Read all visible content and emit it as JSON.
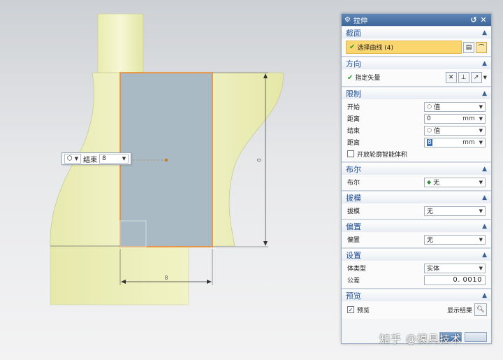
{
  "viewport": {
    "toolbar": {
      "mode_label": "结束",
      "value": "8"
    },
    "dimensions": {
      "height_label": "0",
      "width_label": "8"
    }
  },
  "dialog": {
    "title": "拉伸",
    "sections": {
      "section": {
        "title": "截面",
        "select_curve": "选择曲线 (4)"
      },
      "direction": {
        "title": "方向",
        "specify_vector": "指定矢量"
      },
      "limits": {
        "title": "限制",
        "start_label": "开始",
        "start_value": "值",
        "distance1_label": "距离",
        "distance1_value": "0",
        "distance1_unit": "mm",
        "end_label": "结束",
        "end_value": "值",
        "distance2_label": "距离",
        "distance2_value": "8",
        "distance2_unit": "mm",
        "open_profile_label": "开放轮廓智能体积"
      },
      "boolean": {
        "title": "布尔",
        "label": "布尔",
        "value": "无"
      },
      "draft": {
        "title": "拔模",
        "label": "拔模",
        "value": "无"
      },
      "offset": {
        "title": "偏置",
        "label": "偏置",
        "value": "无"
      },
      "settings": {
        "title": "设置",
        "body_type_label": "体类型",
        "body_type_value": "实体",
        "tolerance_label": "公差",
        "tolerance_value": "0. 0010"
      },
      "preview": {
        "title": "预览",
        "preview_label": "预览",
        "show_result_label": "显示结果"
      }
    }
  },
  "watermark": "知乎 @模具技术",
  "colors": {
    "title_bar": "#4d76a8",
    "highlight": "#fbd66f",
    "section_title": "#1f4f9a",
    "model_yellow": "#eef0b8",
    "sketch_fill": "#a9bac4",
    "sketch_edge": "#f08a2c"
  }
}
